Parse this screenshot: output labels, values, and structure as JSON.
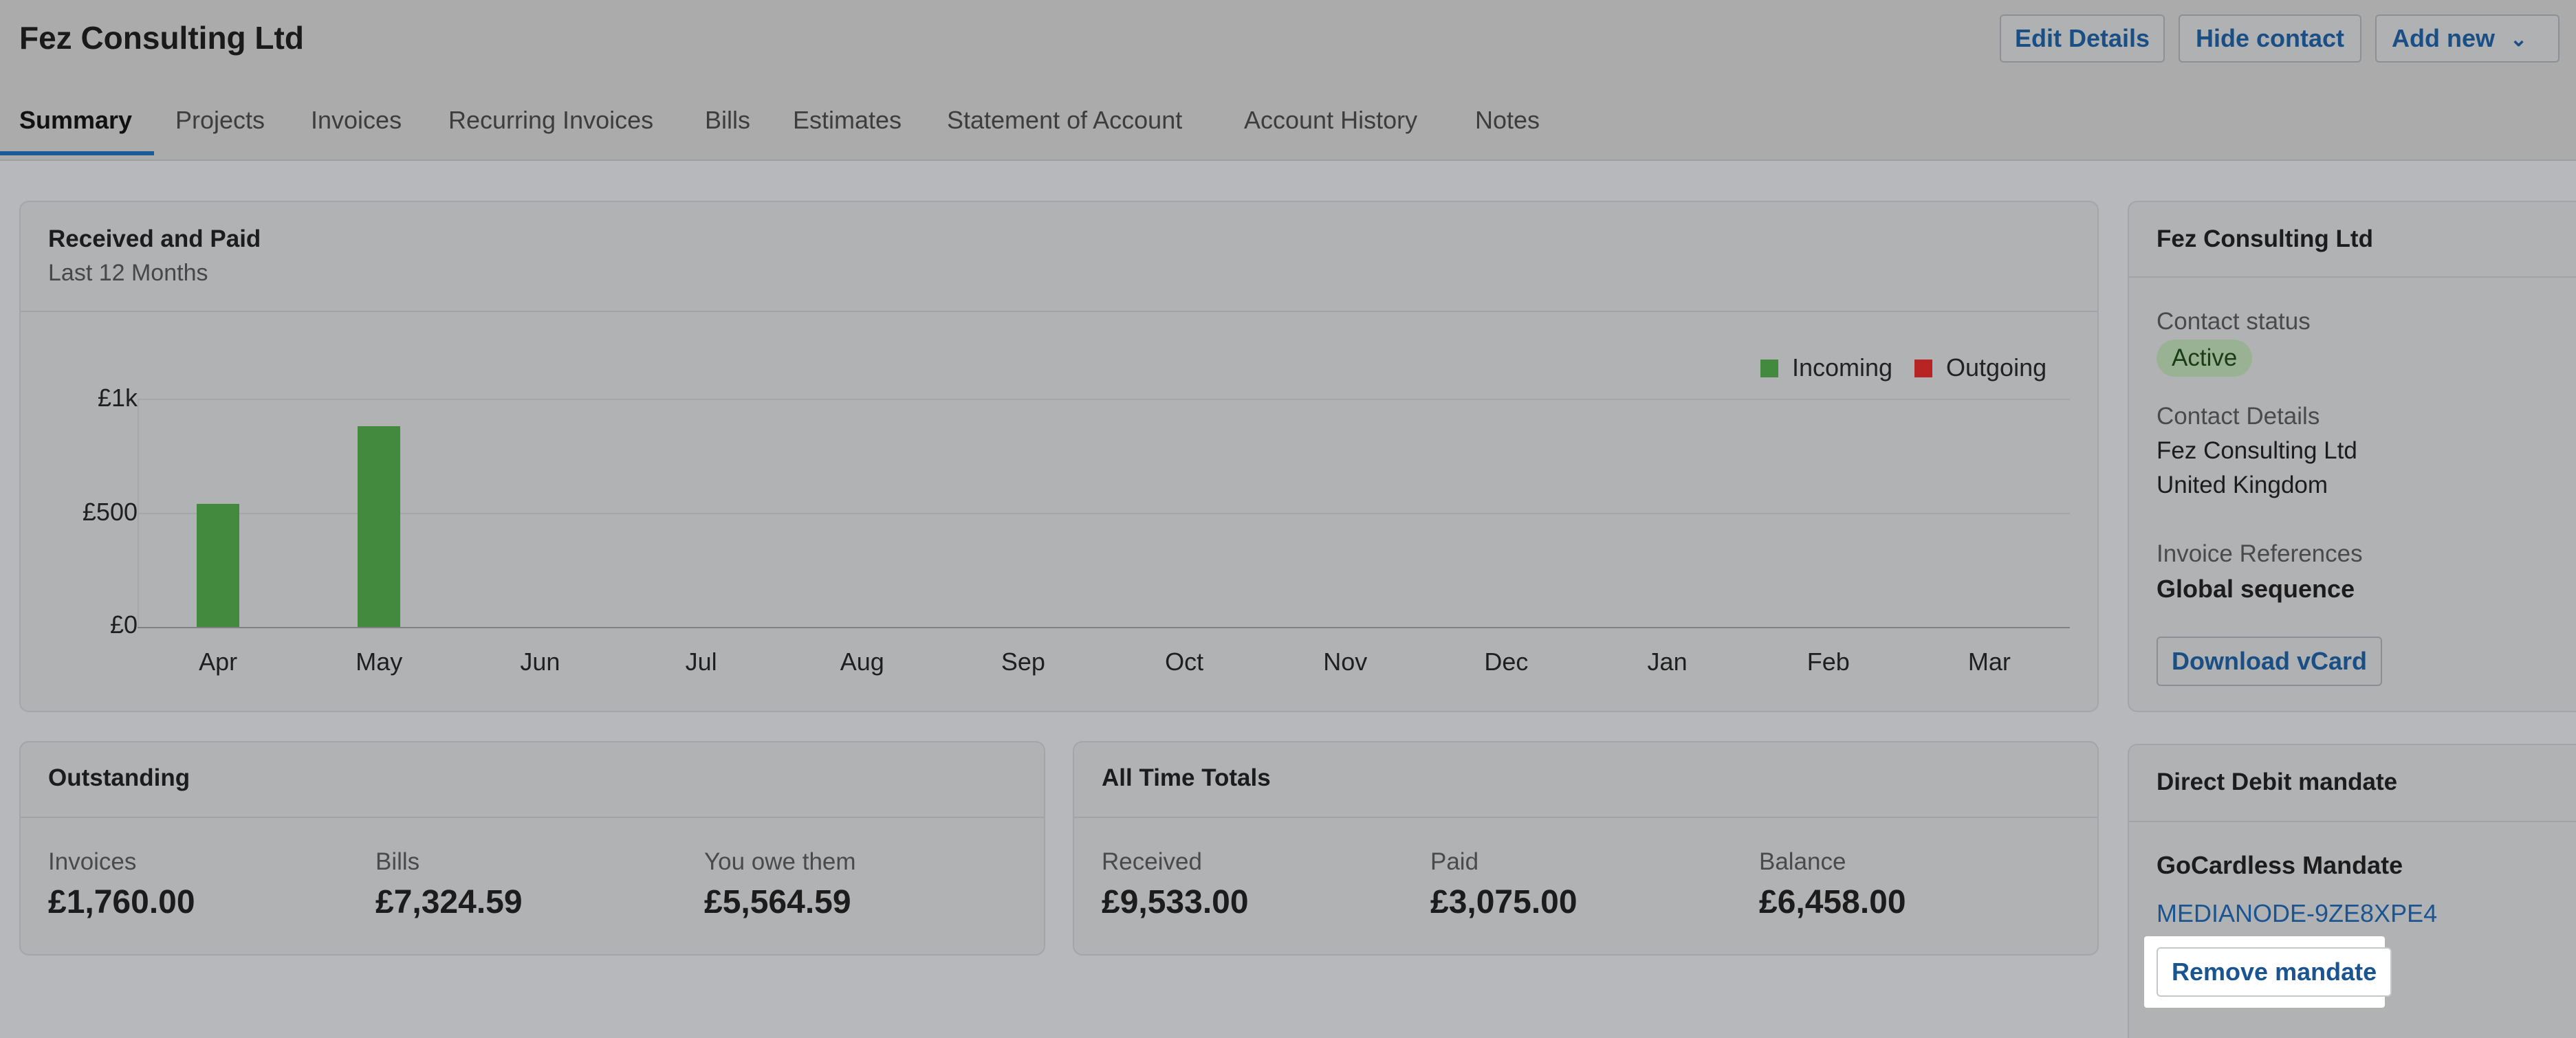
{
  "header": {
    "title": "Fez Consulting Ltd",
    "buttons": {
      "edit": "Edit Details",
      "hide": "Hide contact",
      "add_new": "Add new"
    }
  },
  "tabs": [
    "Summary",
    "Projects",
    "Invoices",
    "Recurring Invoices",
    "Bills",
    "Estimates",
    "Statement of Account",
    "Account History",
    "Notes"
  ],
  "active_tab": "Summary",
  "chart_card": {
    "title": "Received and Paid",
    "subtitle": "Last 12 Months"
  },
  "chart_data": {
    "type": "bar",
    "categories": [
      "Apr",
      "May",
      "Jun",
      "Jul",
      "Aug",
      "Sep",
      "Oct",
      "Nov",
      "Dec",
      "Jan",
      "Feb",
      "Mar"
    ],
    "series": [
      {
        "name": "Incoming",
        "color": "#438a3f",
        "values": [
          540,
          880,
          0,
          0,
          0,
          0,
          0,
          0,
          0,
          0,
          0,
          0
        ]
      },
      {
        "name": "Outgoing",
        "color": "#b82424",
        "values": [
          0,
          0,
          0,
          0,
          0,
          0,
          0,
          0,
          0,
          0,
          0,
          0
        ]
      }
    ],
    "yticks": [
      "£0",
      "£500",
      "£1k"
    ],
    "ylim": [
      0,
      1000
    ],
    "legend": "top-right",
    "grid": true
  },
  "outstanding": {
    "title": "Outstanding",
    "items": [
      {
        "label": "Invoices",
        "value": "£1,760.00"
      },
      {
        "label": "Bills",
        "value": "£7,324.59"
      },
      {
        "label": "You owe them",
        "value": "£5,564.59"
      }
    ]
  },
  "totals": {
    "title": "All Time Totals",
    "items": [
      {
        "label": "Received",
        "value": "£9,533.00"
      },
      {
        "label": "Paid",
        "value": "£3,075.00"
      },
      {
        "label": "Balance",
        "value": "£6,458.00"
      }
    ]
  },
  "contact": {
    "title": "Fez Consulting Ltd",
    "status_label": "Contact status",
    "status": "Active",
    "details_label": "Contact Details",
    "details_name": "Fez Consulting Ltd",
    "details_country": "United Kingdom",
    "references_label": "Invoice References",
    "references_value": "Global sequence",
    "vcard_button": "Download vCard"
  },
  "mandate": {
    "title": "Direct Debit mandate",
    "provider": "GoCardless Mandate",
    "reference": "MEDIANODE-9ZE8XPE4",
    "remove_button": "Remove mandate"
  }
}
